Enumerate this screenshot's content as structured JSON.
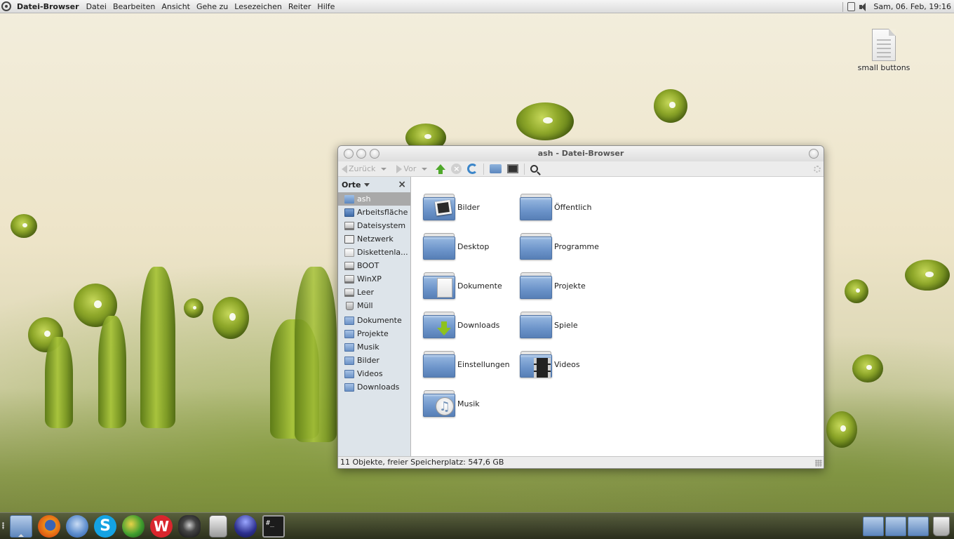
{
  "top_panel": {
    "app_name": "Datei-Browser",
    "menu": [
      {
        "label": "Datei"
      },
      {
        "label": "Bearbeiten"
      },
      {
        "label": "Ansicht"
      },
      {
        "label": "Gehe zu"
      },
      {
        "label": "Lesezeichen"
      },
      {
        "label": "Reiter"
      },
      {
        "label": "Hilfe"
      }
    ],
    "clock": "Sam, 06. Feb, 19:16"
  },
  "desktop": {
    "file_label": "small buttons"
  },
  "window": {
    "title": "ash - Datei-Browser",
    "toolbar": {
      "back_label": "Zurück",
      "forward_label": "Vor"
    },
    "sidebar": {
      "header": "Orte",
      "items": [
        {
          "label": "ash",
          "icon": "home-icon",
          "selected": true
        },
        {
          "label": "Arbeitsfläche",
          "icon": "desktop-icon"
        },
        {
          "label": "Dateisystem",
          "icon": "drive-icon"
        },
        {
          "label": "Netzwerk",
          "icon": "network-icon"
        },
        {
          "label": "Diskettenla...",
          "icon": "floppy-icon"
        },
        {
          "label": "BOOT",
          "icon": "drive-icon"
        },
        {
          "label": "WinXP",
          "icon": "drive-icon"
        },
        {
          "label": "Leer",
          "icon": "drive-icon"
        },
        {
          "label": "Müll",
          "icon": "trash-icon"
        },
        {
          "label": "Dokumente",
          "icon": "folder-icon"
        },
        {
          "label": "Projekte",
          "icon": "folder-icon"
        },
        {
          "label": "Musik",
          "icon": "folder-music-icon"
        },
        {
          "label": "Bilder",
          "icon": "folder-pictures-icon"
        },
        {
          "label": "Videos",
          "icon": "folder-videos-icon"
        },
        {
          "label": "Downloads",
          "icon": "folder-download-icon"
        }
      ]
    },
    "files": [
      {
        "label": "Bilder",
        "emblem": "photo"
      },
      {
        "label": "Öffentlich",
        "emblem": ""
      },
      {
        "label": "Desktop",
        "emblem": ""
      },
      {
        "label": "Programme",
        "emblem": ""
      },
      {
        "label": "Dokumente",
        "emblem": "doc"
      },
      {
        "label": "Projekte",
        "emblem": ""
      },
      {
        "label": "Downloads",
        "emblem": "down"
      },
      {
        "label": "Spiele",
        "emblem": ""
      },
      {
        "label": "Einstellungen",
        "emblem": ""
      },
      {
        "label": "Videos",
        "emblem": "film"
      },
      {
        "label": "Musik",
        "emblem": "music"
      }
    ],
    "status": "11 Objekte, freier Speicherplatz: 547,6 GB"
  },
  "dock": {
    "launchers": [
      "file-manager-icon",
      "firefox-icon",
      "thunderbird-icon",
      "skype-icon",
      "browser-globe-icon",
      "w-app-icon",
      "media-icon",
      "ipod-icon",
      "eclipse-icon",
      "terminal-icon"
    ],
    "terminal_glyph": "#_"
  },
  "colors": {
    "folder_blue": "#6b93c9",
    "sidebar_bg": "#dde4ea",
    "selection": "#a9a9a9"
  }
}
